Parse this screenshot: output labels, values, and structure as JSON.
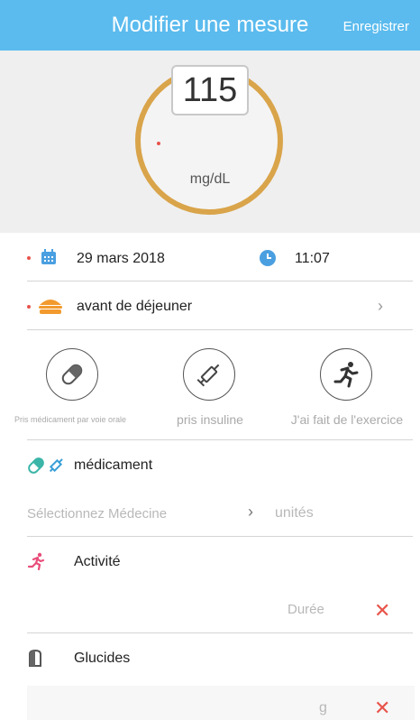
{
  "header": {
    "title": "Modifier une mesure",
    "save_label": "Enregistrer"
  },
  "reading": {
    "value": "115",
    "unit": "mg/dL"
  },
  "date_row": {
    "date": "29 mars 2018",
    "time": "11:07"
  },
  "meal_row": {
    "label": "avant de déjeuner"
  },
  "actions": [
    {
      "label": "Pris médicament par voie orale",
      "icon": "pill-icon"
    },
    {
      "label": "pris insuline",
      "icon": "syringe-icon"
    },
    {
      "label": "J'ai fait de l'exercice",
      "icon": "running-icon"
    }
  ],
  "medication": {
    "title": "médicament",
    "select_placeholder": "Sélectionnez Médecine",
    "units_placeholder": "unités"
  },
  "activity": {
    "title": "Activité",
    "duration_placeholder": "Durée"
  },
  "carbs": {
    "title": "Glucides",
    "grams_placeholder": "g"
  },
  "colors": {
    "header": "#5bbbee",
    "ring": "#d9a44a",
    "accent_red": "#e8534a",
    "teal": "#3ab5a8",
    "pink": "#e84d7a"
  }
}
